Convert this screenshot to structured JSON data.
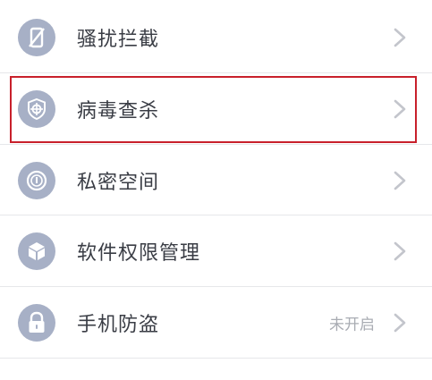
{
  "items": [
    {
      "label": "骚扰拦截",
      "status": "",
      "icon": "blocked-phone-icon"
    },
    {
      "label": "病毒查杀",
      "status": "",
      "icon": "shield-target-icon"
    },
    {
      "label": "私密空间",
      "status": "",
      "icon": "privacy-key-icon"
    },
    {
      "label": "软件权限管理",
      "status": "",
      "icon": "box-cube-icon"
    },
    {
      "label": "手机防盗",
      "status": "未开启",
      "icon": "lock-icon"
    }
  ],
  "colors": {
    "icon_bg": "#a7b0c6",
    "highlight": "#c8202b",
    "chevron": "#c3c5cc"
  }
}
